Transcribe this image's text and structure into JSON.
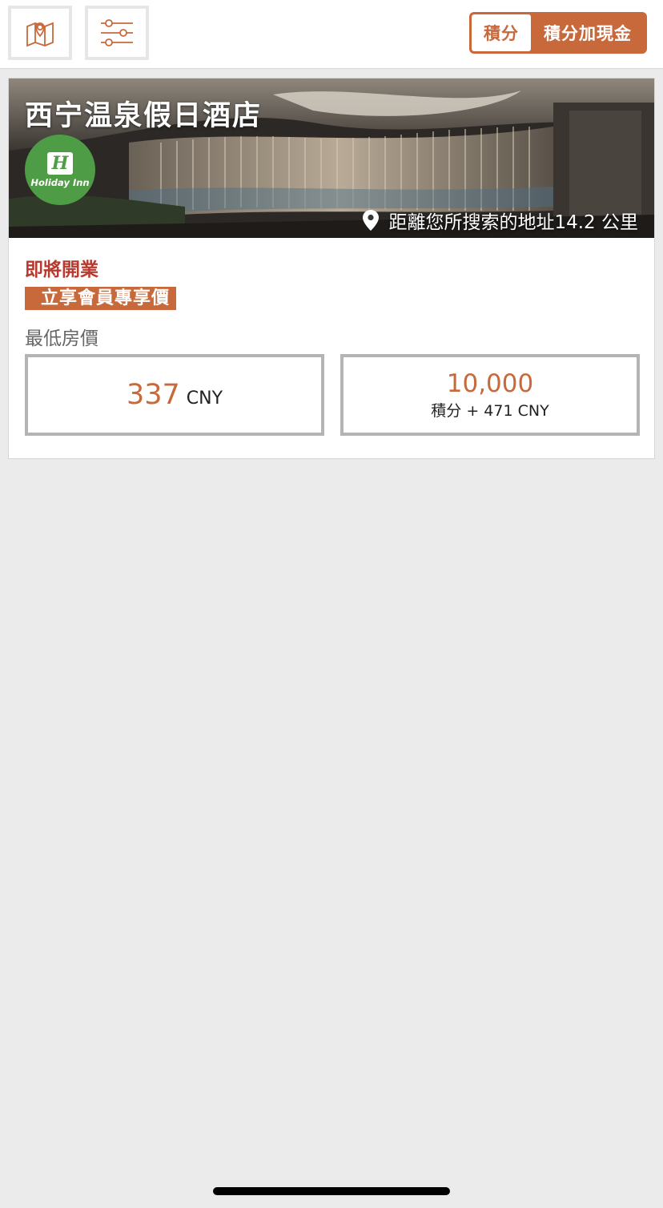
{
  "header": {
    "toggle_points_label": "積分",
    "toggle_points_cash_label": "積分加現金"
  },
  "hotel": {
    "name": "西宁温泉假日酒店",
    "brand_logo_text": "Holiday Inn",
    "brand_logo_mark": "H",
    "distance_text": "距離您所搜索的地址14.2 公里",
    "status": "即將開業",
    "member_badge": "立享會員專享價",
    "lowest_price_label": "最低房價",
    "cash_price": {
      "amount": "337",
      "currency": "CNY"
    },
    "points_price": {
      "points": "10,000",
      "detail": "積分 + 471 CNY"
    }
  },
  "colors": {
    "accent": "#c8693b",
    "status_red": "#b83a2e",
    "brand_green": "#4e9d46",
    "background": "#ebebeb"
  },
  "icons": {
    "map": "map-icon",
    "filter": "filter-sliders-icon",
    "location": "location-pin-icon"
  }
}
